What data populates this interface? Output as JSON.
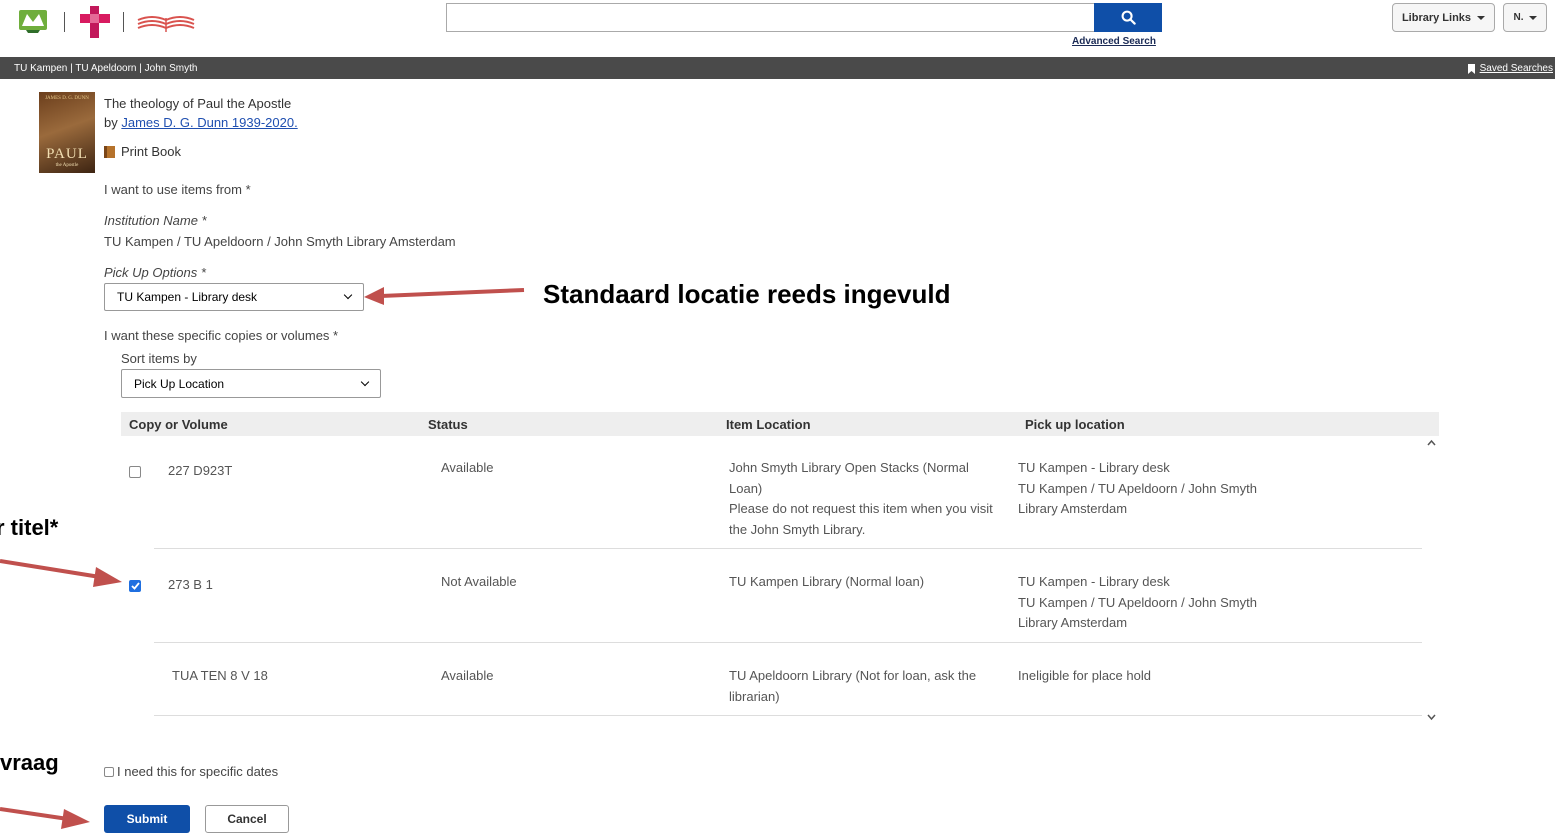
{
  "header": {
    "search_placeholder": "",
    "advanced_search": "Advanced Search",
    "library_links": "Library Links",
    "user_menu": "N."
  },
  "nav": {
    "breadcrumb": "TU Kampen | TU Apeldoorn | John Smyth",
    "saved_searches": "Saved Searches"
  },
  "book": {
    "title": "The theology of Paul the Apostle",
    "by_prefix": "by",
    "author": "James D. G. Dunn 1939-2020.",
    "format": "Print Book",
    "cover_top": "JAMES D. G. DUNN",
    "cover_main": "PAUL",
    "cover_sub": "the Apostle"
  },
  "form": {
    "use_items_label": "I want to use items from *",
    "institution_label": "Institution Name *",
    "institution_value": "TU Kampen / TU Apeldoorn / John Smyth Library Amsterdam",
    "pickup_label": "Pick Up Options *",
    "pickup_value": "TU Kampen - Library desk",
    "copies_label": "I want these specific copies or volumes *",
    "sort_label": "Sort items by",
    "sort_value": "Pick Up Location",
    "specific_dates": "I need this for specific dates",
    "submit": "Submit",
    "cancel": "Cancel"
  },
  "table": {
    "headers": [
      "Copy or Volume",
      "Status",
      "Item Location",
      "Pick up location"
    ],
    "rows": [
      {
        "copy": "227 D923T",
        "status": "Available",
        "location_lines": [
          "John Smyth Library Open Stacks (Normal",
          "Loan)",
          "Please do not request this item when you visit",
          "the John Smyth Library."
        ],
        "pickup_lines": [
          "TU Kampen - Library desk",
          "TU Kampen / TU Apeldoorn / John Smyth",
          "Library Amsterdam"
        ],
        "checked": false
      },
      {
        "copy": "273 B 1",
        "status": "Not Available",
        "location_lines": [
          "TU Kampen Library (Normal loan)"
        ],
        "pickup_lines": [
          "TU Kampen - Library desk",
          "TU Kampen / TU Apeldoorn / John Smyth",
          "Library Amsterdam"
        ],
        "checked": true
      },
      {
        "copy": "TUA TEN 8 V 18",
        "status": "Available",
        "location_lines": [
          "TU Apeldoorn Library (Not for loan, ask the",
          "librarian)"
        ],
        "pickup_lines": [
          "Ineligible for place hold"
        ],
        "checked": false
      }
    ]
  },
  "annotations": {
    "default_location": "Standaard locatie reeds ingevuld",
    "title_note": "r titel*",
    "request_note": "vraag"
  },
  "colors": {
    "primary": "#0f4fa8",
    "dark_bar": "#4a4a4a",
    "arrow": "#c0504d",
    "link": "#1f4fb0"
  }
}
